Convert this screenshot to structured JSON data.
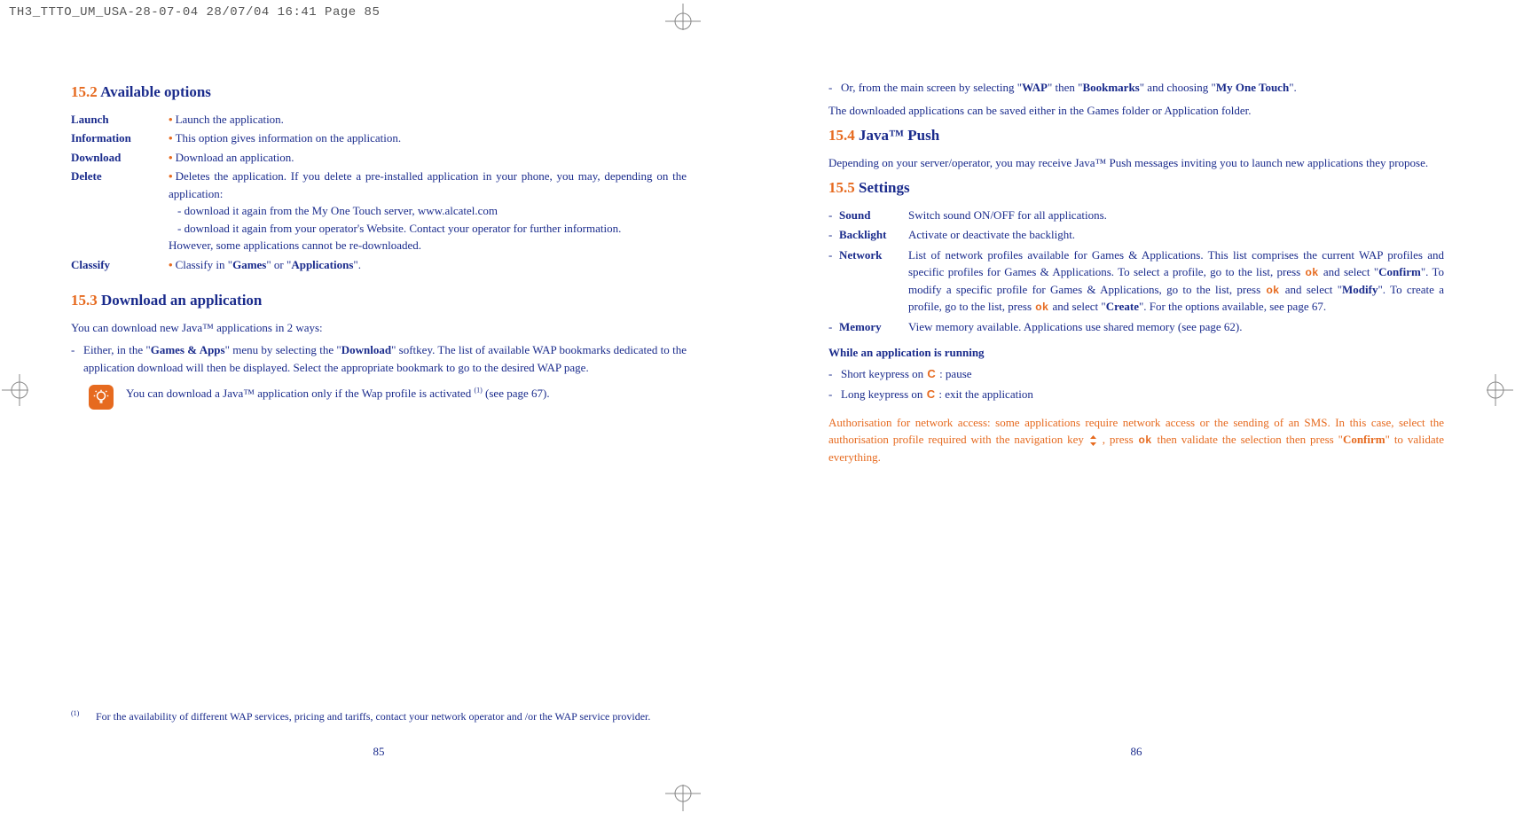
{
  "print_header": "TH3_TTTO_UM_USA-28-07-04  28/07/04  16:41  Page 85",
  "left": {
    "h152_num": "15.2",
    "h152_title": "Available options",
    "options": {
      "launch": {
        "label": "Launch",
        "text": "Launch the application."
      },
      "information": {
        "label": "Information",
        "text": "This option gives information on the application."
      },
      "download": {
        "label": "Download",
        "text": "Download an application."
      },
      "delete": {
        "label": "Delete",
        "lead": "Deletes the application. If you delete a pre-installed application in your phone, you may, depending on the application:",
        "sub1": "- download it again from the My One Touch server, www.alcatel.com",
        "sub2": "- download it again from your operator's Website. Contact your operator for further information.",
        "tail": "However, some applications cannot be re-downloaded."
      },
      "classify": {
        "label": "Classify",
        "pre": "Classify in \"",
        "b1": "Games",
        "mid": "\" or \"",
        "b2": "Applications",
        "post": "\"."
      }
    },
    "h153_num": "15.3",
    "h153_title": "Download an application",
    "intro": "You can download new Java™ applications in 2 ways:",
    "bullet1": {
      "pre": "Either, in the \"",
      "b1": "Games & Apps",
      "mid1": "\" menu by selecting the \"",
      "b2": "Download",
      "post": "\" softkey. The list of available WAP bookmarks dedicated to the application download will then be displayed. Select the appropriate bookmark to go to the desired WAP page."
    },
    "callout": {
      "pre": "You can download a Java™ application only if the Wap profile is activated ",
      "fn": "(1)",
      "post": " (see page 67)."
    },
    "footnote": {
      "mark": "(1)",
      "text": "For the availability of different WAP services, pricing and tariffs, contact your network operator and /or the WAP service provider."
    },
    "page_num": "85"
  },
  "right": {
    "bullet2": {
      "pre": "Or, from the main screen by selecting \"",
      "b1": "WAP",
      "mid1": "\" then \"",
      "b2": "Bookmarks",
      "mid2": "\" and choosing \"",
      "b3": "My One Touch",
      "post": "\"."
    },
    "after": "The downloaded applications can be saved either in the Games folder or Application folder.",
    "h154_num": "15.4",
    "h154_title": "Java™ Push",
    "push_body": "Depending on your server/operator, you may receive Java™ Push messages inviting you to launch new applications they propose.",
    "h155_num": "15.5",
    "h155_title": "Settings",
    "settings": {
      "sound": {
        "label": "Sound",
        "text": "Switch sound ON/OFF for all applications."
      },
      "backlight": {
        "label": "Backlight",
        "text": "Activate or deactivate the backlight."
      },
      "network": {
        "label": "Network",
        "p1a": "List of network profiles available for Games & Applications. This list comprises the current WAP profiles and specific profiles for Games & Applications. To select a profile, go to the list, press ",
        "p1b": " and select \"",
        "b1": "Confirm",
        "p1c": "\". To modify a specific profile for Games & Applications, go to the list, press ",
        "p1d": " and select \"",
        "b2": "Modify",
        "p1e": "\". To create a profile, go to the list, press ",
        "p1f": " and select \"",
        "b3": "Create",
        "p1g": "\". For the options available, see page 67."
      },
      "memory": {
        "label": "Memory",
        "text": "View memory available. Applications use shared memory (see page 62)."
      }
    },
    "running_head": "While an application is running",
    "run1a": "Short keypress on ",
    "run1b": " : pause",
    "run2a": "Long keypress on ",
    "run2b": " : exit the application",
    "auth": {
      "p1": "Authorisation for network access: some applications require network access or the sending of an SMS. In this case, select the authorisation profile required with the navigation key ",
      "p2": " , press ",
      "p3": " then validate the selection then press \"",
      "b1": "Confirm",
      "p4": "\" to validate everything."
    },
    "page_num": "86"
  },
  "glyphs": {
    "ok": "ok",
    "ckey": "C"
  }
}
